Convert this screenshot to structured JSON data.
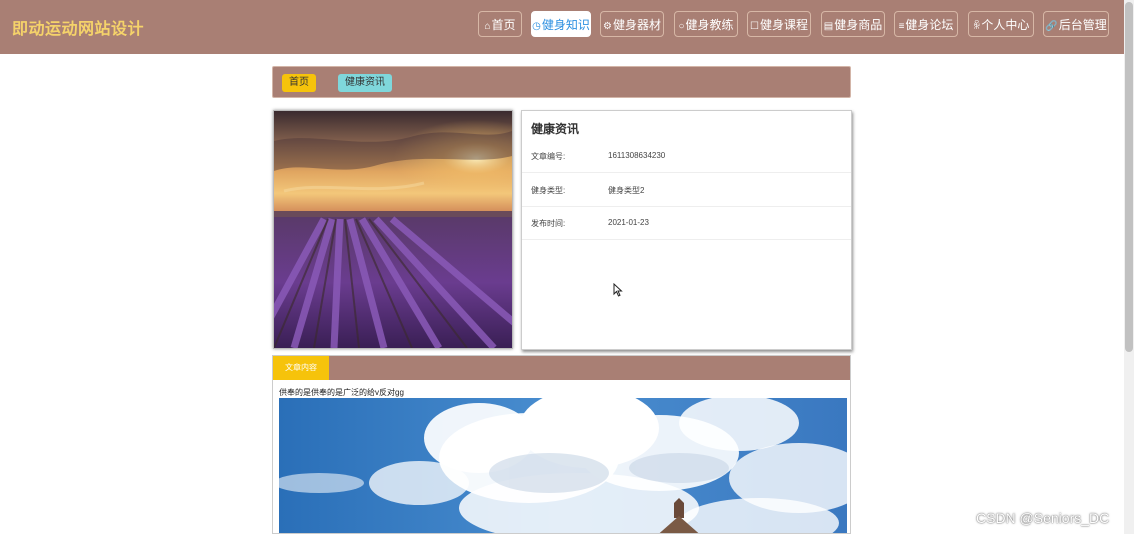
{
  "header": {
    "site_title": "即动运动网站设计",
    "nav": [
      {
        "icon": "home-icon",
        "glyph": "⌂",
        "label": "首页",
        "active": false
      },
      {
        "icon": "compass-icon",
        "glyph": "◷",
        "label": "健身知识",
        "active": true
      },
      {
        "icon": "gear-icon",
        "glyph": "⚙",
        "label": "健身器材",
        "active": false
      },
      {
        "icon": "circle-icon",
        "glyph": "○",
        "label": "健身教练",
        "active": false
      },
      {
        "icon": "square-icon",
        "glyph": "☐",
        "label": "健身课程",
        "active": false
      },
      {
        "icon": "grid-icon",
        "glyph": "▤",
        "label": "健身商品",
        "active": false
      },
      {
        "icon": "list-icon",
        "glyph": "≡",
        "label": "健身论坛",
        "active": false
      },
      {
        "icon": "user-icon",
        "glyph": "ꆜ",
        "label": "个人中心",
        "active": false
      },
      {
        "icon": "link-icon",
        "glyph": "🔗",
        "label": "后台管理",
        "active": false
      }
    ]
  },
  "breadcrumb": {
    "home": "首页",
    "current": "健康资讯"
  },
  "info": {
    "title": "健康资讯",
    "rows": [
      {
        "label": "文章编号:",
        "value": "1611308634230"
      },
      {
        "label": "健身类型:",
        "value": "健身类型2"
      },
      {
        "label": "发布时间:",
        "value": "2021-01-23"
      }
    ]
  },
  "content": {
    "tab_label": "文章内容",
    "text": "供奉的是供奉的是广泛的给v反对gg"
  },
  "watermark": "CSDN @Seniors_DC",
  "colors": {
    "header_bg": "#a97f74",
    "title": "#f5d36a",
    "accent_yellow": "#f6c30b",
    "accent_cyan": "#7fd7db"
  }
}
